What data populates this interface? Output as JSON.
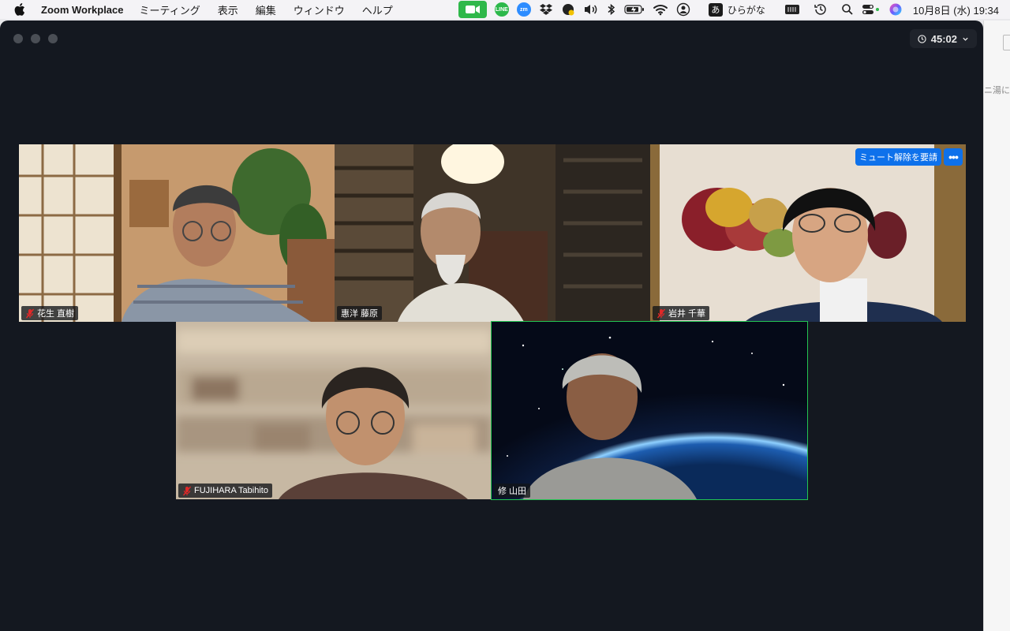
{
  "menubar": {
    "app_name": "Zoom Workplace",
    "menus": [
      "ミーティング",
      "表示",
      "編集",
      "ウィンドウ",
      "ヘルプ"
    ],
    "tray_icons": [
      "zoom-video-icon",
      "line-icon",
      "zoom-chat-icon",
      "dropbox-icon",
      "vpn-icon",
      "volume-icon",
      "bluetooth-icon",
      "battery-icon",
      "wifi-icon",
      "user-icon"
    ],
    "ime_char": "あ",
    "ime_label": "ひらがな",
    "clock": "10月8日 (水)  19:34",
    "line_label": "LINE",
    "zoom_label": "zm"
  },
  "window": {
    "timer": "45:02",
    "background_peek_text": "ニ湯に新"
  },
  "participants": [
    {
      "name": "花生 直樹",
      "muted": true
    },
    {
      "name": "惠洋 藤原",
      "muted": false
    },
    {
      "name": "岩井 千華",
      "muted": true,
      "hover_button": "ミュート解除を要請",
      "more": "•••"
    },
    {
      "name": "FUJIHARA Tabihito",
      "muted": true
    },
    {
      "name": "修 山田",
      "muted": false,
      "active_speaker": true
    }
  ],
  "colors": {
    "speaking_border": "#23c552",
    "accent_blue": "#0e71eb",
    "meeting_bg": "#141820",
    "mute_red": "#e02828"
  }
}
